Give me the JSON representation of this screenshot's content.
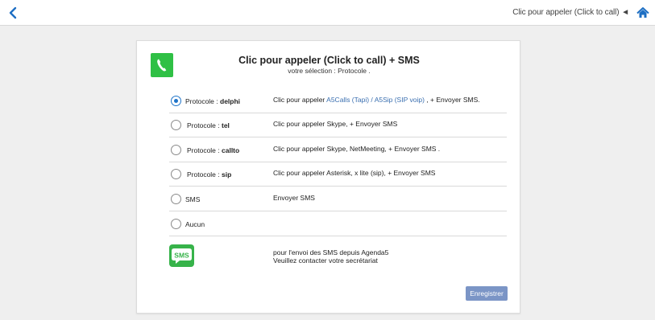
{
  "topbar": {
    "title": "Clic pour appeler (Click to call) ◄"
  },
  "header": {
    "title": "Clic pour appeler (Click to call) + SMS",
    "subtitle": "votre sélection : Protocole ."
  },
  "options": [
    {
      "prefix": "Protocole : ",
      "name": "delphi",
      "checked": true,
      "desc_pre": "Clic pour appeler ",
      "link1": "A5Calls (Tapi)",
      "sep": " / ",
      "link2": "A5Sip (SIP voip)",
      "desc_post": " , + Envoyer SMS."
    },
    {
      "prefix": "Protocole : ",
      "name": "tel",
      "checked": false,
      "desc": "Clic pour appeler Skype, + Envoyer SMS"
    },
    {
      "prefix": "Protocole : ",
      "name": "callto",
      "checked": false,
      "desc": "Clic pour appeler Skype, NetMeeting, + Envoyer SMS ."
    },
    {
      "prefix": "Protocole : ",
      "name": "sip",
      "checked": false,
      "desc": "Clic pour appeler Asterisk, x lite (sip), + Envoyer SMS"
    },
    {
      "label": "SMS",
      "checked": false,
      "desc": "Envoyer SMS"
    },
    {
      "label": "Aucun",
      "checked": false,
      "desc": ""
    }
  ],
  "sms_note": {
    "icon_label": "SMS",
    "line1": "pour l'envoi des SMS depuis Agenda5",
    "line2": "Veuillez contacter votre secrétariat"
  },
  "save_label": "Enregistrer",
  "colors": {
    "accent": "#1e74c9",
    "button": "#7b95c6",
    "green": "#2fc045",
    "link": "#3a6fb0"
  }
}
